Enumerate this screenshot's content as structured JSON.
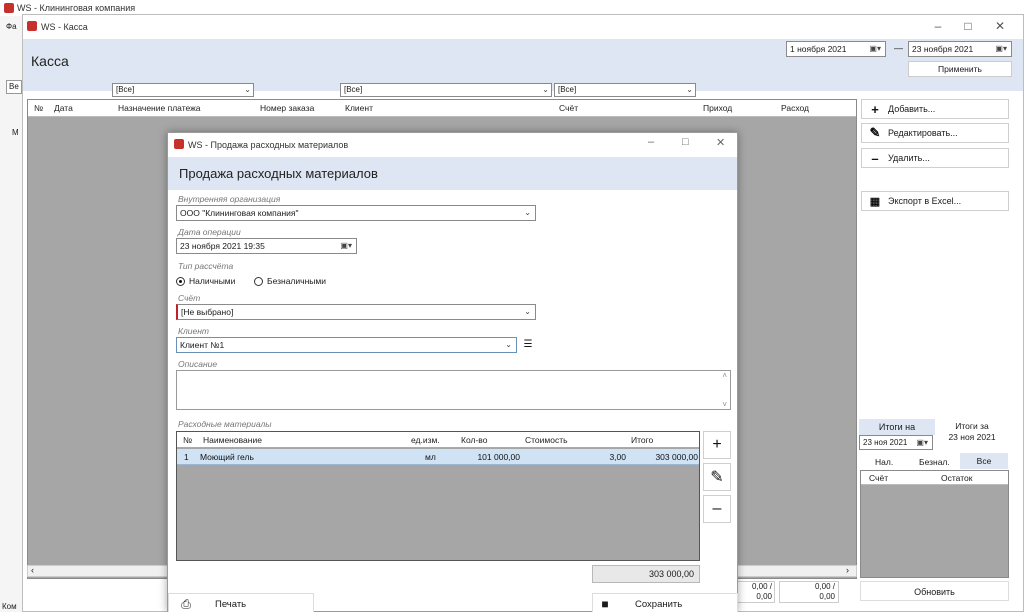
{
  "outer_window": {
    "title": "WS - Клининговая компания",
    "left_stub_label": "Фа",
    "left_stub_item": "М",
    "left_stub_bottom": "Ком",
    "left_stub_dropdown": "Ве"
  },
  "kassa_window": {
    "title": "WS - Касса",
    "heading": "Касса",
    "date_from": "1 ноября 2021",
    "date_to": "23 ноября 2021",
    "date_sep": "—",
    "apply_button": "Применить",
    "filters": [
      "[Все]",
      "[Все]",
      "[Все]"
    ],
    "columns": [
      "№",
      "Дата",
      "Назначение платежа",
      "Номер заказа",
      "Клиент",
      "Счёт",
      "Приход",
      "Расход"
    ],
    "actions": {
      "add": "Добавить...",
      "edit": "Редактировать...",
      "delete": "Удалить...",
      "export": "Экспорт в Excel..."
    },
    "totals": {
      "tab_on": "Итоги на",
      "tab_for": "Итоги за",
      "date_on": "23 ноя 2021",
      "date_for": "23 ноя 2021",
      "subtabs": [
        "Нал.",
        "Безнал.",
        "Все"
      ],
      "columns": [
        "Счёт",
        "Остаток"
      ],
      "refresh_button": "Обновить"
    },
    "bottom_values": [
      "0,00 /",
      "0,00",
      "0,00 /",
      "0,00"
    ]
  },
  "dialog": {
    "title": "WS - Продажа расходных материалов",
    "heading": "Продажа расходных материалов",
    "org_label": "Внутренняя организация",
    "org_value": "ООО \"Клининговая компания\"",
    "date_label": "Дата операции",
    "date_value": "23 ноября 2021 19:35",
    "payment_label": "Тип рассчёта",
    "payment_options": [
      "Наличными",
      "Безналичными"
    ],
    "account_label": "Счёт",
    "account_value": "[Не выбрано]",
    "client_label": "Клиент",
    "client_value": "Клиент №1",
    "description_label": "Описание",
    "materials_label": "Расходные материалы",
    "grid_columns": [
      "№",
      "Наименование",
      "ед.изм.",
      "Кол-во",
      "Стоимость",
      "Итого"
    ],
    "rows": [
      {
        "num": "1",
        "name": "Моющий гель",
        "unit": "мл",
        "qty": "101 000,00",
        "price": "3,00",
        "total": "303 000,00"
      }
    ],
    "grand_total": "303 000,00",
    "print_button": "Печать",
    "save_button": "Сохранить"
  },
  "colors": {
    "header_band": "#dde6f2",
    "selected_row": "#cfe3f5",
    "error_marker": "#c0202a",
    "app_icon": "#c8302c"
  }
}
